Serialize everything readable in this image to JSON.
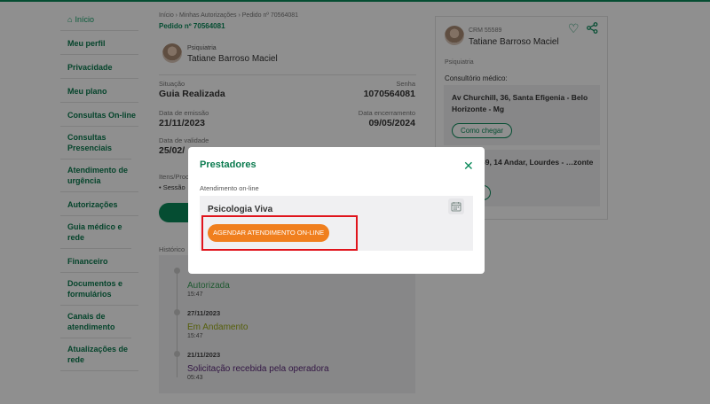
{
  "sidebar": {
    "items": [
      {
        "label": "Início"
      },
      {
        "label": "Meu perfil"
      },
      {
        "label": "Privacidade"
      },
      {
        "label": "Meu plano"
      },
      {
        "label": "Consultas On-line"
      },
      {
        "label": "Consultas Presenciais"
      },
      {
        "label": "Atendimento de urgência"
      },
      {
        "label": "Autorizações"
      },
      {
        "label": "Guia médico e rede"
      },
      {
        "label": "Financeiro"
      },
      {
        "label": "Documentos e formulários"
      },
      {
        "label": "Canais de atendimento"
      },
      {
        "label": "Atualizações de rede"
      }
    ]
  },
  "breadcrumb": {
    "text": "Início › Minhas Autorizações › Pedido nº 70564081",
    "order": "Pedido nº 70564081"
  },
  "doctor": {
    "specialty": "Psiquiatria",
    "name": "Tatiane Barroso Maciel"
  },
  "fields": {
    "situacao_label": "Situação",
    "situacao_value": "Guia Realizada",
    "senha_label": "Senha",
    "senha_value": "1070564081",
    "emissao_label": "Data de emissão",
    "emissao_value": "21/11/2023",
    "encerramento_label": "Data encerramento",
    "encerramento_value": "09/05/2024",
    "validade_label": "Data de validade",
    "validade_value": "25/02/",
    "itens_label": "Itens/Proc",
    "itens_value": "• Sessão"
  },
  "history": {
    "label": "Histórico",
    "events": [
      {
        "date": "",
        "status": "Autorizada",
        "time": "15:47",
        "color": "#3aa05a"
      },
      {
        "date": "27/11/2023",
        "status": "Em Andamento",
        "time": "15:47",
        "color": "#9aaa16"
      },
      {
        "date": "21/11/2023",
        "status": "Solicitação recebida pela operadora",
        "time": "05:43",
        "color": "#5b2a7a"
      }
    ]
  },
  "right_card": {
    "crm": "CRM 55589",
    "name": "Tatiane Barroso Maciel",
    "specialty": "Psiquiatria",
    "consultorio_label": "Consultório médico:",
    "address1": "Av Churchill, 36, Santa Efigenia - Belo Horizonte - Mg",
    "address2": "…no, 7069, 14 Andar, Lourdes - …zonte - Mg",
    "como_chegar": "Como chegar",
    "como_chegar_2": "…egar"
  },
  "modal": {
    "title": "Prestadores",
    "close": "✕",
    "subtitle": "Atendimento on-line",
    "provider_name": "Psicologia Viva",
    "button": "AGENDAR ATENDIMENTO ON-LINE"
  },
  "colors": {
    "brand_green": "#0a8a5a",
    "orange": "#f07f1e",
    "highlight_red": "#e0141c"
  }
}
